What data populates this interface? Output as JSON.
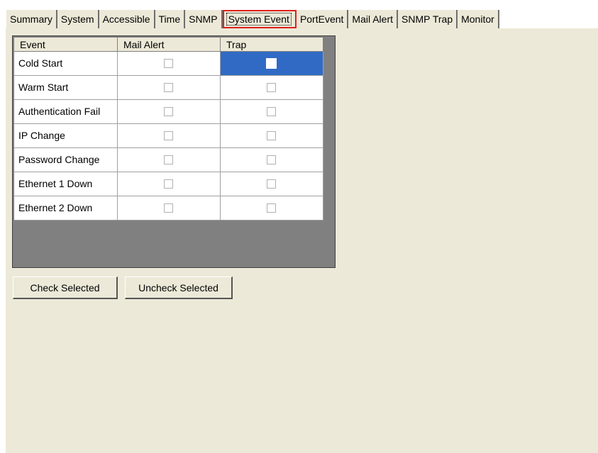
{
  "tabs": [
    {
      "label": "Summary"
    },
    {
      "label": "System"
    },
    {
      "label": "Accessible"
    },
    {
      "label": "Time"
    },
    {
      "label": "SNMP"
    },
    {
      "label": "System Event",
      "active": true
    },
    {
      "label": "PortEvent"
    },
    {
      "label": "Mail Alert"
    },
    {
      "label": "SNMP Trap"
    },
    {
      "label": "Monitor"
    }
  ],
  "grid": {
    "columns": [
      "Event",
      "Mail Alert",
      "Trap"
    ],
    "rows": [
      {
        "event": "Cold Start",
        "mail_alert": false,
        "trap": false,
        "trap_selected": true
      },
      {
        "event": "Warm Start",
        "mail_alert": false,
        "trap": false
      },
      {
        "event": "Authentication Fail",
        "mail_alert": false,
        "trap": false
      },
      {
        "event": "IP Change",
        "mail_alert": false,
        "trap": false
      },
      {
        "event": "Password Change",
        "mail_alert": false,
        "trap": false
      },
      {
        "event": "Ethernet 1 Down",
        "mail_alert": false,
        "trap": false
      },
      {
        "event": "Ethernet 2 Down",
        "mail_alert": false,
        "trap": false
      }
    ]
  },
  "buttons": {
    "check_selected": "Check Selected",
    "uncheck_selected": "Uncheck Selected"
  },
  "colors": {
    "panel": "#ece9d8",
    "selection": "#316ac5",
    "tab_highlight": "#e0201d"
  }
}
